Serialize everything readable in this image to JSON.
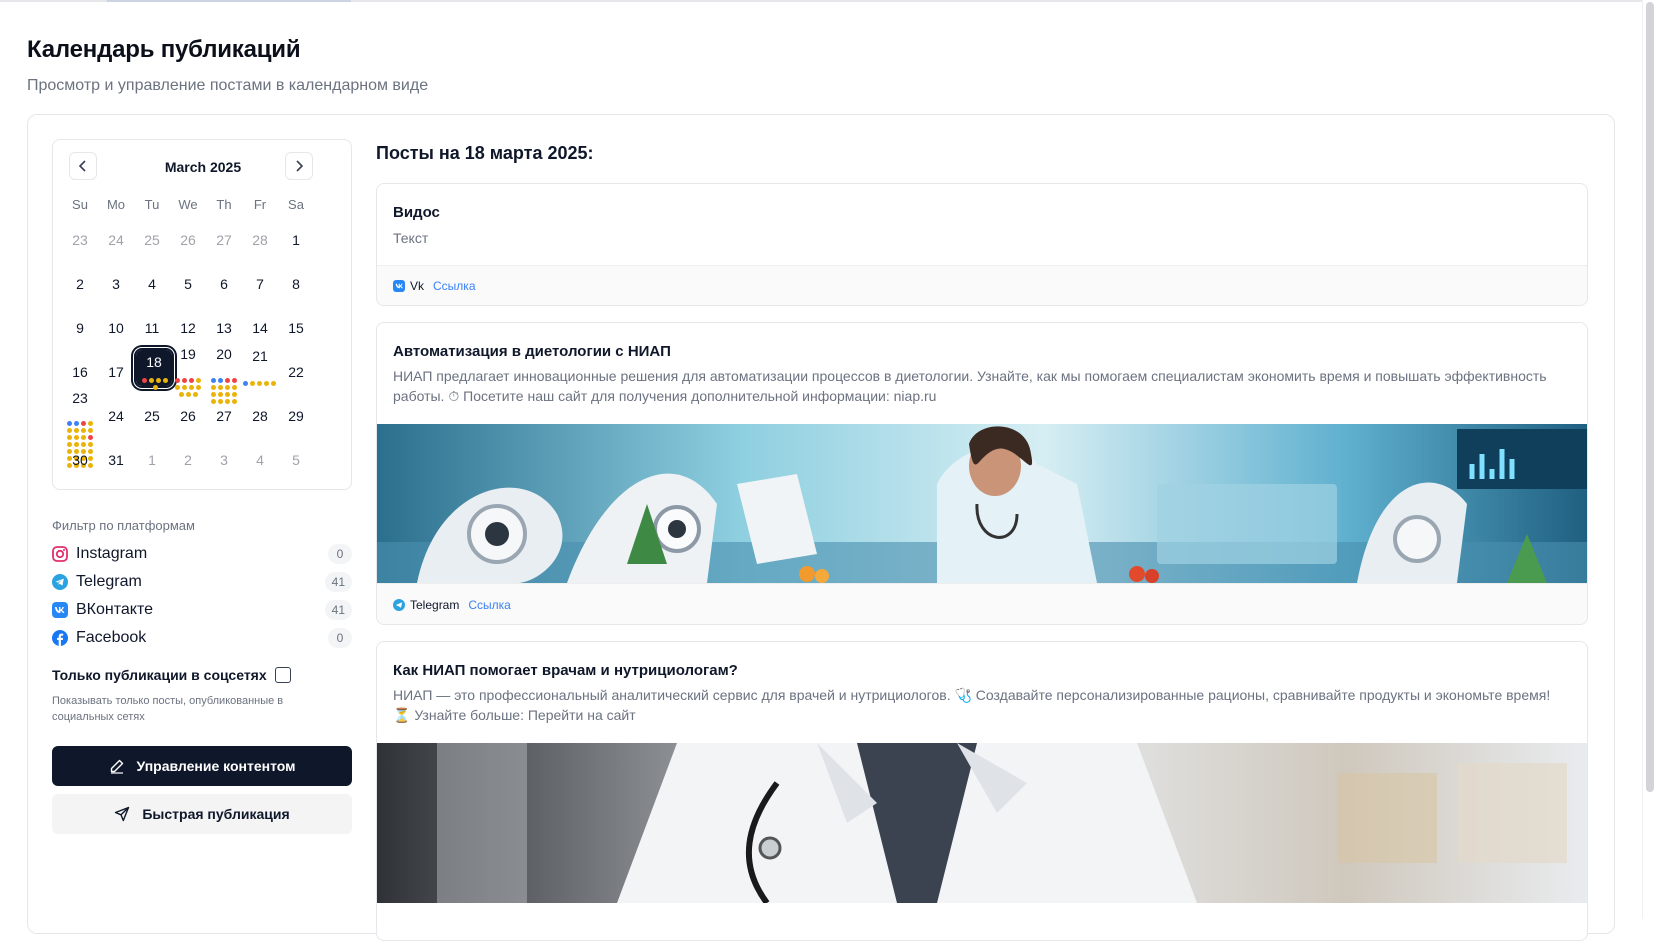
{
  "page": {
    "title": "Календарь публикаций",
    "subtitle": "Просмотр и управление постами в календарном виде"
  },
  "calendar": {
    "month_label": "March 2025",
    "weekdays": [
      "Su",
      "Mo",
      "Tu",
      "We",
      "Th",
      "Fr",
      "Sa"
    ],
    "weeks": [
      [
        "23",
        "24",
        "25",
        "26",
        "27",
        "28",
        "1"
      ],
      [
        "2",
        "3",
        "4",
        "5",
        "6",
        "7",
        "8"
      ],
      [
        "9",
        "10",
        "11",
        "12",
        "13",
        "14",
        "15"
      ],
      [
        "16",
        "17",
        "18",
        "19",
        "20",
        "21",
        "22"
      ],
      [
        "23",
        "24",
        "25",
        "26",
        "27",
        "28",
        "29"
      ],
      [
        "30",
        "31",
        "1",
        "2",
        "3",
        "4",
        "5"
      ]
    ],
    "selected_day": "18"
  },
  "filter": {
    "title": "Фильтр по платформам",
    "platforms": [
      {
        "label": "Instagram",
        "count": "0",
        "icon": "instagram-icon",
        "color": "#e1306c"
      },
      {
        "label": "Telegram",
        "count": "41",
        "icon": "telegram-icon",
        "color": "#2aa3e0"
      },
      {
        "label": "ВКонтакте",
        "count": "41",
        "icon": "vk-icon",
        "color": "#2787f5"
      },
      {
        "label": "Facebook",
        "count": "0",
        "icon": "facebook-icon",
        "color": "#1877f2"
      }
    ],
    "only_social_label": "Только публикации в соцсетях",
    "only_social_desc": "Показывать только посты, опубликованные в социальных сетях"
  },
  "buttons": {
    "manage": "Управление контентом",
    "quick": "Быстрая публикация"
  },
  "posts": {
    "heading": "Посты на 18 марта 2025:",
    "items": [
      {
        "title": "Видос",
        "text": "Текст",
        "platform": "Vk",
        "link": "Ссылка"
      },
      {
        "title": "Автоматизация в диетологии с НИАП",
        "text": "НИАП предлагает инновационные решения для автоматизации процессов в диетологии. Узнайте, как мы помогаем специалистам экономить время и повышать эффективность работы. ⏱ Посетите наш сайт для получения дополнительной информации: niap.ru",
        "platform": "Telegram",
        "link": "Ссылка"
      },
      {
        "title": "Как НИАП помогает врачам и нутрициологам?",
        "text": "НИАП — это профессиональный аналитический сервис для врачей и нутрициологов. 🩺 Создавайте персонализированные рационы, сравнивайте продукты и экономьте время! ⏳ Узнайте больше: Перейти на сайт"
      }
    ]
  },
  "colors": {
    "primary": "#0f172a",
    "link": "#3b82f6",
    "dot_red": "#ef4444",
    "dot_yellow": "#eab308",
    "dot_blue": "#3b82f6"
  }
}
